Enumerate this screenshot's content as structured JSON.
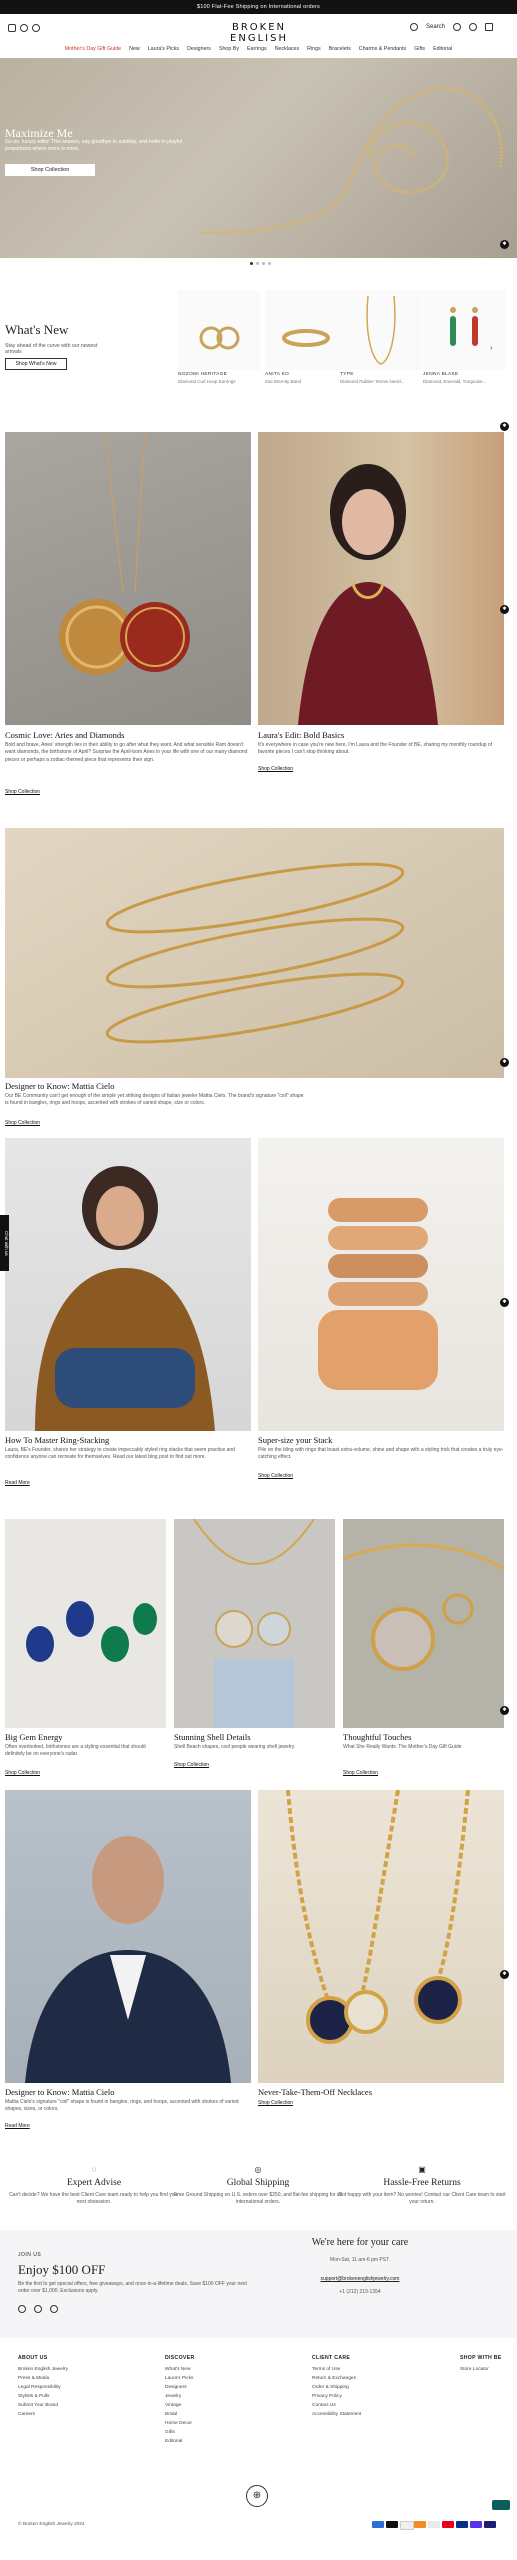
{
  "banner": {
    "text": "$100 Flat-Fee Shipping on International orders"
  },
  "header": {
    "logo": "BROKEN ENGLISH",
    "search_label": "Search",
    "nav": [
      "Mother's Day Gift Guide",
      "New",
      "Laura's Picks",
      "Designers",
      "Shop By",
      "Earrings",
      "Necklaces",
      "Rings",
      "Bracelets",
      "Charms & Pendants",
      "Gifts",
      "Editorial"
    ]
  },
  "hero": {
    "title": "Maximize Me",
    "text": "Go on, luxury edits! This season, say goodbye to subtlety, and hello to playful proportions where more is more.",
    "button": "Shop Collection"
  },
  "whats_new": {
    "title": "What's New",
    "subtitle": "Stay ahead of the curve with our newest arrivals",
    "button": "Shop What's New",
    "products": [
      {
        "brand": "NOZOMI HERITAGE",
        "name": "Diamond Curl Hoop Earrings"
      },
      {
        "brand": "ANITA KO",
        "name": "Zoe Eternity Band"
      },
      {
        "brand": "TYPE",
        "name": "Diamond Rubber Tennis Neckl..."
      },
      {
        "brand": "JENNA BLAKE",
        "name": "Diamond, Emerald, Turquoise..."
      }
    ]
  },
  "row1": [
    {
      "title": "Cosmic Love: Aries and Diamonds",
      "text": "Bold and brave, Aries' strength lies in their ability to go after what they want. And what sensible Ram doesn't want diamonds, the birthstone of April? Surprise the April-born Aries in your life with one of our many diamond pieces or perhaps a zodiac-themed piece that represents their sign.",
      "link": "Shop Collection"
    },
    {
      "title": "Laura's Edit: Bold Basics",
      "text": "It's everywhere in case you're new here, I'm Laura and the Founder of BE, sharing my monthly roundup of favorite pieces I can't stop thinking about.",
      "link": "Shop Collection"
    }
  ],
  "designer": {
    "title": "Designer to Know: Mattia Cielo",
    "text": "Our BE Community can't get enough of the simple yet striking designs of Italian jeweler Mattia Cielo. The brand's signature \"coil\" shape is found in bangles, rings and hoops, accented with strokes of varied shape, size or colors.",
    "link": "Shop Collection"
  },
  "row2": [
    {
      "title": "How To Master Ring-Stacking",
      "text": "Laura, BE's Founder, shares her strategy to create impeccably styled ring stacks that seem practice and confidence anyone can recreate for themselves. Read our latest blog post to find out more.",
      "link": "Read More"
    },
    {
      "title": "Super-size your Stack",
      "text": "Pile on the bling with rings that boast extra-volume, shine and shape with a styling trick that creates a truly eye-catching effect.",
      "link": "Shop Collection"
    }
  ],
  "row3": [
    {
      "title": "Big Gem Energy",
      "text": "Often overlooked, birthstones are a styling essential that should definitely be on everyone's radar.",
      "link": "Shop Collection"
    },
    {
      "title": "Stunning Shell Details",
      "text": "Shell Beach shapes, cool people wearing shell jewelry.",
      "link": "Shop Collection"
    },
    {
      "title": "Thoughtful Touches",
      "text": "What She Really Wants: The Mother's Day Gift Guide",
      "link": "Shop Collection"
    }
  ],
  "row4": [
    {
      "title": "Designer to Know: Mattia Cielo",
      "text": "Mattia Cielo's signature \"coil\" shape is found in bangles, rings, and hoops, accented with strokes of varied shapes, sizes, or colors.",
      "link": "Read More"
    },
    {
      "title": "Never-Take-Them-Off Necklaces",
      "text": "",
      "link": "Shop Collection"
    }
  ],
  "features": [
    {
      "title": "Expert Advise",
      "text": "Can't decide? We have the best Client Care team ready to help you find your next obsession."
    },
    {
      "title": "Global Shipping",
      "text": "Free Ground Shipping on U.S. orders over $250, and flat-fee shipping for all international orders."
    },
    {
      "title": "Hassle-Free Returns",
      "text": "Not happy with your item? No worries! Contact our Client Care team to start your return."
    }
  ],
  "signup": {
    "eyebrow": "JOIN US",
    "title": "Enjoy $100 OFF",
    "text": "Be the first to get special offers, free giveaways, and once-in-a-lifetime deals. Save $100 OFF your next order over $1,000. Exclusions apply.",
    "care_title": "We're here for your care",
    "hours": "Mon-Sat, 11 am-6 pm PST.",
    "email": "support@brokenenglishjewelry.com",
    "phone": "+1 (212) 219-1354"
  },
  "footer": {
    "columns": [
      {
        "head": "ABOUT US",
        "links": [
          "Broken English Jewelry",
          "Press & Media",
          "Legal Responsibility",
          "Stylists & Pulls",
          "Submit Your Brand",
          "Careers"
        ]
      },
      {
        "head": "DISCOVER",
        "links": [
          "What's New",
          "Laura's Picks",
          "Designers",
          "Jewelry",
          "Vintage",
          "Bridal",
          "Home Decor",
          "Gifts",
          "Editorial"
        ]
      },
      {
        "head": "CLIENT CARE",
        "links": [
          "Terms of Use",
          "Return & Exchanges",
          "Order & Shipping",
          "Privacy Policy",
          "Contact Us",
          "Accessibility Statement"
        ]
      },
      {
        "head": "SHOP WITH BE",
        "links": [
          "Store Locator"
        ]
      }
    ],
    "copyright": "© Broken English Jewelry 2024",
    "chat": "Chat with us"
  },
  "colors": {
    "accent": "#c0392b",
    "dark": "#111111",
    "signup_bg": "#f5f5f7"
  }
}
